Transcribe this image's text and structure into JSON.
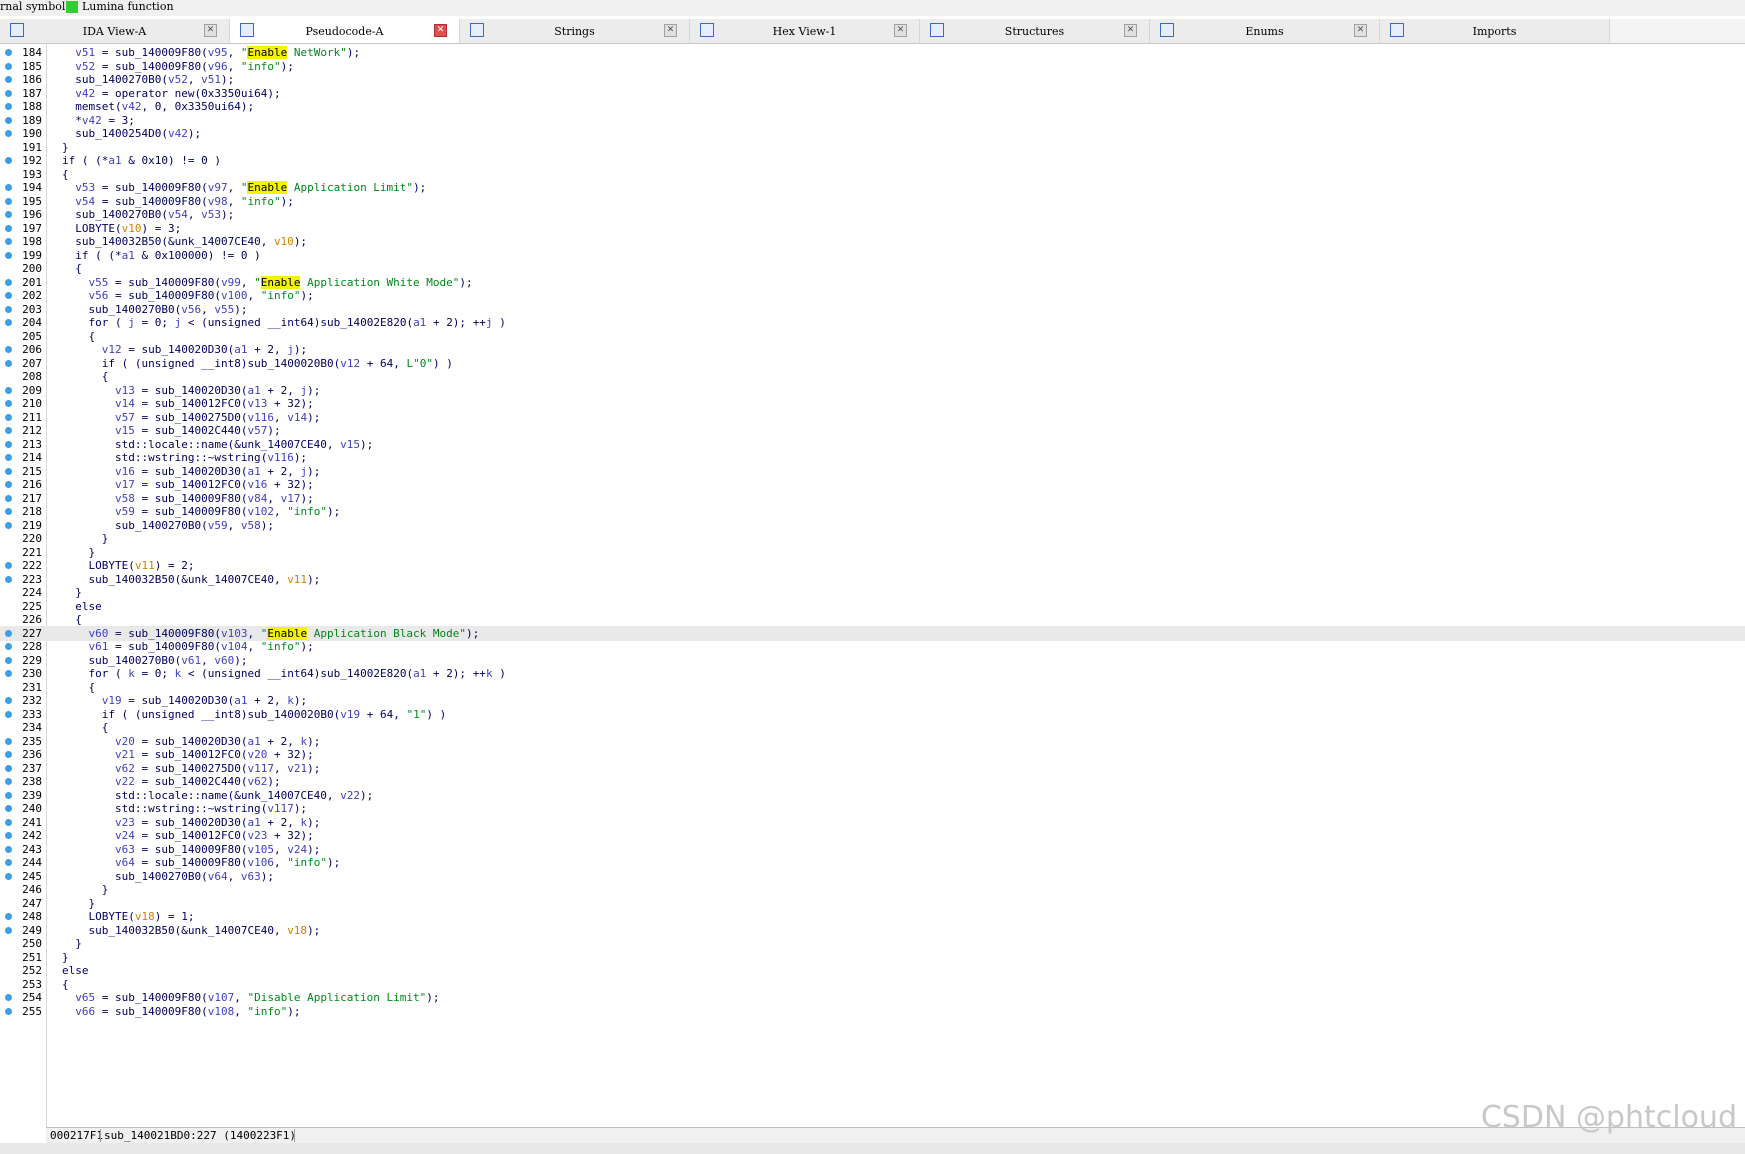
{
  "legend": {
    "text1": "rnal symbol",
    "text2": "Lumina function"
  },
  "tabs": [
    {
      "label": "IDA View-A",
      "active": false
    },
    {
      "label": "Pseudocode-A",
      "active": true
    },
    {
      "label": "Strings",
      "active": false
    },
    {
      "label": "Hex View-1",
      "active": false
    },
    {
      "label": "Structures",
      "active": false
    },
    {
      "label": "Enums",
      "active": false
    },
    {
      "label": "Imports",
      "active": false
    }
  ],
  "current_line": 227,
  "lines": [
    {
      "n": "184",
      "dot": true,
      "t": "  v51 = sub_140009F80(v95, \"Enable NetWork\");"
    },
    {
      "n": "185",
      "dot": true,
      "t": "  v52 = sub_140009F80(v96, \"info\");"
    },
    {
      "n": "186",
      "dot": true,
      "t": "  sub_1400270B0(v52, v51);"
    },
    {
      "n": "187",
      "dot": true,
      "t": "  v42 = operator new(0x3350ui64);"
    },
    {
      "n": "188",
      "dot": true,
      "t": "  memset(v42, 0, 0x3350ui64);"
    },
    {
      "n": "189",
      "dot": true,
      "t": "  *v42 = 3;"
    },
    {
      "n": "190",
      "dot": true,
      "t": "  sub_1400254D0(v42);"
    },
    {
      "n": "191",
      "dot": false,
      "t": "}"
    },
    {
      "n": "192",
      "dot": true,
      "t": "if ( (*a1 & 0x10) != 0 )"
    },
    {
      "n": "193",
      "dot": false,
      "t": "{"
    },
    {
      "n": "194",
      "dot": true,
      "t": "  v53 = sub_140009F80(v97, \"Enable Application Limit\");"
    },
    {
      "n": "195",
      "dot": true,
      "t": "  v54 = sub_140009F80(v98, \"info\");"
    },
    {
      "n": "196",
      "dot": true,
      "t": "  sub_1400270B0(v54, v53);"
    },
    {
      "n": "197",
      "dot": true,
      "t": "  LOBYTE(v10) = 3;"
    },
    {
      "n": "198",
      "dot": true,
      "t": "  sub_140032B50(&unk_14007CE40, v10);"
    },
    {
      "n": "199",
      "dot": true,
      "t": "  if ( (*a1 & 0x100000) != 0 )"
    },
    {
      "n": "200",
      "dot": false,
      "t": "  {"
    },
    {
      "n": "201",
      "dot": true,
      "t": "    v55 = sub_140009F80(v99, \"Enable Application White Mode\");"
    },
    {
      "n": "202",
      "dot": true,
      "t": "    v56 = sub_140009F80(v100, \"info\");"
    },
    {
      "n": "203",
      "dot": true,
      "t": "    sub_1400270B0(v56, v55);"
    },
    {
      "n": "204",
      "dot": true,
      "t": "    for ( j = 0; j < (unsigned __int64)sub_14002E820(a1 + 2); ++j )"
    },
    {
      "n": "205",
      "dot": false,
      "t": "    {"
    },
    {
      "n": "206",
      "dot": true,
      "t": "      v12 = sub_140020D30(a1 + 2, j);"
    },
    {
      "n": "207",
      "dot": true,
      "t": "      if ( (unsigned __int8)sub_1400020B0(v12 + 64, L\"0\") )"
    },
    {
      "n": "208",
      "dot": false,
      "t": "      {"
    },
    {
      "n": "209",
      "dot": true,
      "t": "        v13 = sub_140020D30(a1 + 2, j);"
    },
    {
      "n": "210",
      "dot": true,
      "t": "        v14 = sub_140012FC0(v13 + 32);"
    },
    {
      "n": "211",
      "dot": true,
      "t": "        v57 = sub_1400275D0(v116, v14);"
    },
    {
      "n": "212",
      "dot": true,
      "t": "        v15 = sub_14002C440(v57);"
    },
    {
      "n": "213",
      "dot": true,
      "t": "        std::locale::name(&unk_14007CE40, v15);"
    },
    {
      "n": "214",
      "dot": true,
      "t": "        std::wstring::~wstring(v116);"
    },
    {
      "n": "215",
      "dot": true,
      "t": "        v16 = sub_140020D30(a1 + 2, j);"
    },
    {
      "n": "216",
      "dot": true,
      "t": "        v17 = sub_140012FC0(v16 + 32);"
    },
    {
      "n": "217",
      "dot": true,
      "t": "        v58 = sub_140009F80(v84, v17);"
    },
    {
      "n": "218",
      "dot": true,
      "t": "        v59 = sub_140009F80(v102, \"info\");"
    },
    {
      "n": "219",
      "dot": true,
      "t": "        sub_1400270B0(v59, v58);"
    },
    {
      "n": "220",
      "dot": false,
      "t": "      }"
    },
    {
      "n": "221",
      "dot": false,
      "t": "    }"
    },
    {
      "n": "222",
      "dot": true,
      "t": "    LOBYTE(v11) = 2;"
    },
    {
      "n": "223",
      "dot": true,
      "t": "    sub_140032B50(&unk_14007CE40, v11);"
    },
    {
      "n": "224",
      "dot": false,
      "t": "  }"
    },
    {
      "n": "225",
      "dot": false,
      "t": "  else"
    },
    {
      "n": "226",
      "dot": false,
      "t": "  {"
    },
    {
      "n": "227",
      "dot": true,
      "t": "    v60 = sub_140009F80(v103, \"Enable Application Black Mode\");"
    },
    {
      "n": "228",
      "dot": true,
      "t": "    v61 = sub_140009F80(v104, \"info\");"
    },
    {
      "n": "229",
      "dot": true,
      "t": "    sub_1400270B0(v61, v60);"
    },
    {
      "n": "230",
      "dot": true,
      "t": "    for ( k = 0; k < (unsigned __int64)sub_14002E820(a1 + 2); ++k )"
    },
    {
      "n": "231",
      "dot": false,
      "t": "    {"
    },
    {
      "n": "232",
      "dot": true,
      "t": "      v19 = sub_140020D30(a1 + 2, k);"
    },
    {
      "n": "233",
      "dot": true,
      "t": "      if ( (unsigned __int8)sub_1400020B0(v19 + 64, \"1\") )"
    },
    {
      "n": "234",
      "dot": false,
      "t": "      {"
    },
    {
      "n": "235",
      "dot": true,
      "t": "        v20 = sub_140020D30(a1 + 2, k);"
    },
    {
      "n": "236",
      "dot": true,
      "t": "        v21 = sub_140012FC0(v20 + 32);"
    },
    {
      "n": "237",
      "dot": true,
      "t": "        v62 = sub_1400275D0(v117, v21);"
    },
    {
      "n": "238",
      "dot": true,
      "t": "        v22 = sub_14002C440(v62);"
    },
    {
      "n": "239",
      "dot": true,
      "t": "        std::locale::name(&unk_14007CE40, v22);"
    },
    {
      "n": "240",
      "dot": true,
      "t": "        std::wstring::~wstring(v117);"
    },
    {
      "n": "241",
      "dot": true,
      "t": "        v23 = sub_140020D30(a1 + 2, k);"
    },
    {
      "n": "242",
      "dot": true,
      "t": "        v24 = sub_140012FC0(v23 + 32);"
    },
    {
      "n": "243",
      "dot": true,
      "t": "        v63 = sub_140009F80(v105, v24);"
    },
    {
      "n": "244",
      "dot": true,
      "t": "        v64 = sub_140009F80(v106, \"info\");"
    },
    {
      "n": "245",
      "dot": true,
      "t": "        sub_1400270B0(v64, v63);"
    },
    {
      "n": "246",
      "dot": false,
      "t": "      }"
    },
    {
      "n": "247",
      "dot": false,
      "t": "    }"
    },
    {
      "n": "248",
      "dot": true,
      "t": "    LOBYTE(v18) = 1;"
    },
    {
      "n": "249",
      "dot": true,
      "t": "    sub_140032B50(&unk_14007CE40, v18);"
    },
    {
      "n": "250",
      "dot": false,
      "t": "  }"
    },
    {
      "n": "251",
      "dot": false,
      "t": "}"
    },
    {
      "n": "252",
      "dot": false,
      "t": "else"
    },
    {
      "n": "253",
      "dot": false,
      "t": "{"
    },
    {
      "n": "254",
      "dot": true,
      "t": "  v65 = sub_140009F80(v107, \"Disable Application Limit\");"
    },
    {
      "n": "255",
      "dot": true,
      "t": "  v66 = sub_140009F80(v108, \"info\");"
    }
  ],
  "status": {
    "address": "000217F1",
    "location": "sub_140021BD0:227 (1400223F1)"
  },
  "watermark": "CSDN @phtcloud",
  "colors": {
    "dot": "#3d9ee8",
    "highlight": "#f4f400",
    "string": "#00881a",
    "variable": "#4040c0"
  }
}
